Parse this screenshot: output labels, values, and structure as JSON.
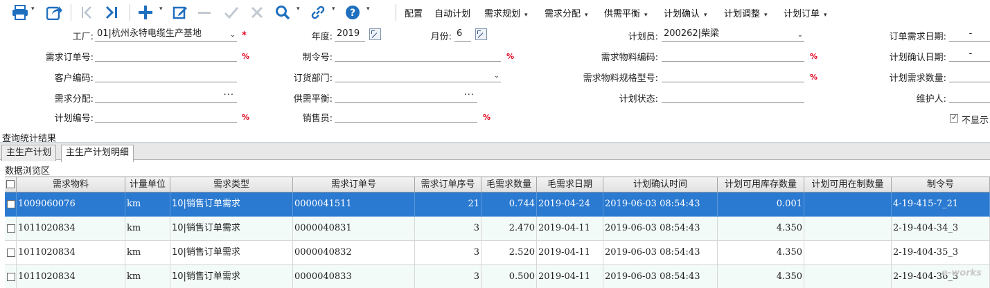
{
  "toolbar": {
    "icons": [
      "print-icon",
      "export-icon",
      "first-page-icon",
      "last-page-icon",
      "add-icon",
      "edit-icon",
      "remove-icon",
      "confirm-icon",
      "cancel-icon",
      "search-icon",
      "link-icon",
      "help-icon"
    ],
    "menus": [
      "配置",
      "自动计划",
      "需求规划",
      "需求分配",
      "供需平衡",
      "计划确认",
      "计划调整",
      "计划订单"
    ]
  },
  "form": {
    "factory_label": "工厂:",
    "factory_value": "01|杭州永特电缆生产基地",
    "year_label": "年度:",
    "year_value": "2019",
    "month_label": "月份:",
    "month_value": "6",
    "planner_label": "计划员:",
    "planner_value": "200262|柴梁",
    "order_demand_date_label": "订单需求日期:",
    "order_demand_date_value": "-",
    "demand_order_no_label": "需求订单号:",
    "work_order_no_label": "制令号:",
    "demand_material_code_label": "需求物料编码:",
    "plan_confirm_date_label": "计划确认日期:",
    "plan_confirm_date_value": "-",
    "customer_code_label": "客户编码:",
    "order_dept_label": "订货部门:",
    "demand_material_spec_label": "需求物料规格型号:",
    "plan_demand_qty_label": "计划需求数量:",
    "demand_allocation_label": "需求分配:",
    "supply_balance_label": "供需平衡:",
    "plan_status_label": "计划状态:",
    "maintainer_label": "维护人:",
    "plan_no_label": "计划编号:",
    "salesperson_label": "销售员:",
    "hide_label": "不显示",
    "ellipsis": "···",
    "percent": "%",
    "required": "*"
  },
  "results_title": "查询统计结果",
  "tabs": [
    "主生产计划",
    "主生产计划明细"
  ],
  "browse_title": "数据浏览区",
  "grid": {
    "columns": [
      "需求物料",
      "计量单位",
      "需求类型",
      "需求订单号",
      "需求订单序号",
      "毛需求数量",
      "毛需求日期",
      "计划确认时间",
      "计划可用库存数量",
      "计划可用在制数量",
      "制令号"
    ],
    "rows": [
      [
        "1009060076",
        "km",
        "10|销售订单需求",
        "0000041511",
        "21",
        "0.744",
        "2019-04-24",
        "2019-06-03 08:54:43",
        "0.001",
        "",
        "4-19-415-7_21"
      ],
      [
        "1011020834",
        "km",
        "10|销售订单需求",
        "0000040831",
        "3",
        "2.470",
        "2019-04-11",
        "2019-06-03 08:54:43",
        "4.350",
        "",
        "2-19-404-34_3"
      ],
      [
        "1011020834",
        "km",
        "10|销售订单需求",
        "0000040832",
        "3",
        "2.520",
        "2019-04-11",
        "2019-06-03 08:54:43",
        "4.350",
        "",
        "2-19-404-35_3"
      ],
      [
        "1011020834",
        "km",
        "10|销售订单需求",
        "0000040833",
        "3",
        "0.500",
        "2019-04-11",
        "2019-06-03 08:54:43",
        "4.350",
        "",
        "2-19-404-36_3"
      ]
    ]
  },
  "watermark": "e-works",
  "colors": {
    "icon_blue": "#1f6fbf",
    "selected_row": "#2b7ad1",
    "required_red": "#e0001b"
  }
}
